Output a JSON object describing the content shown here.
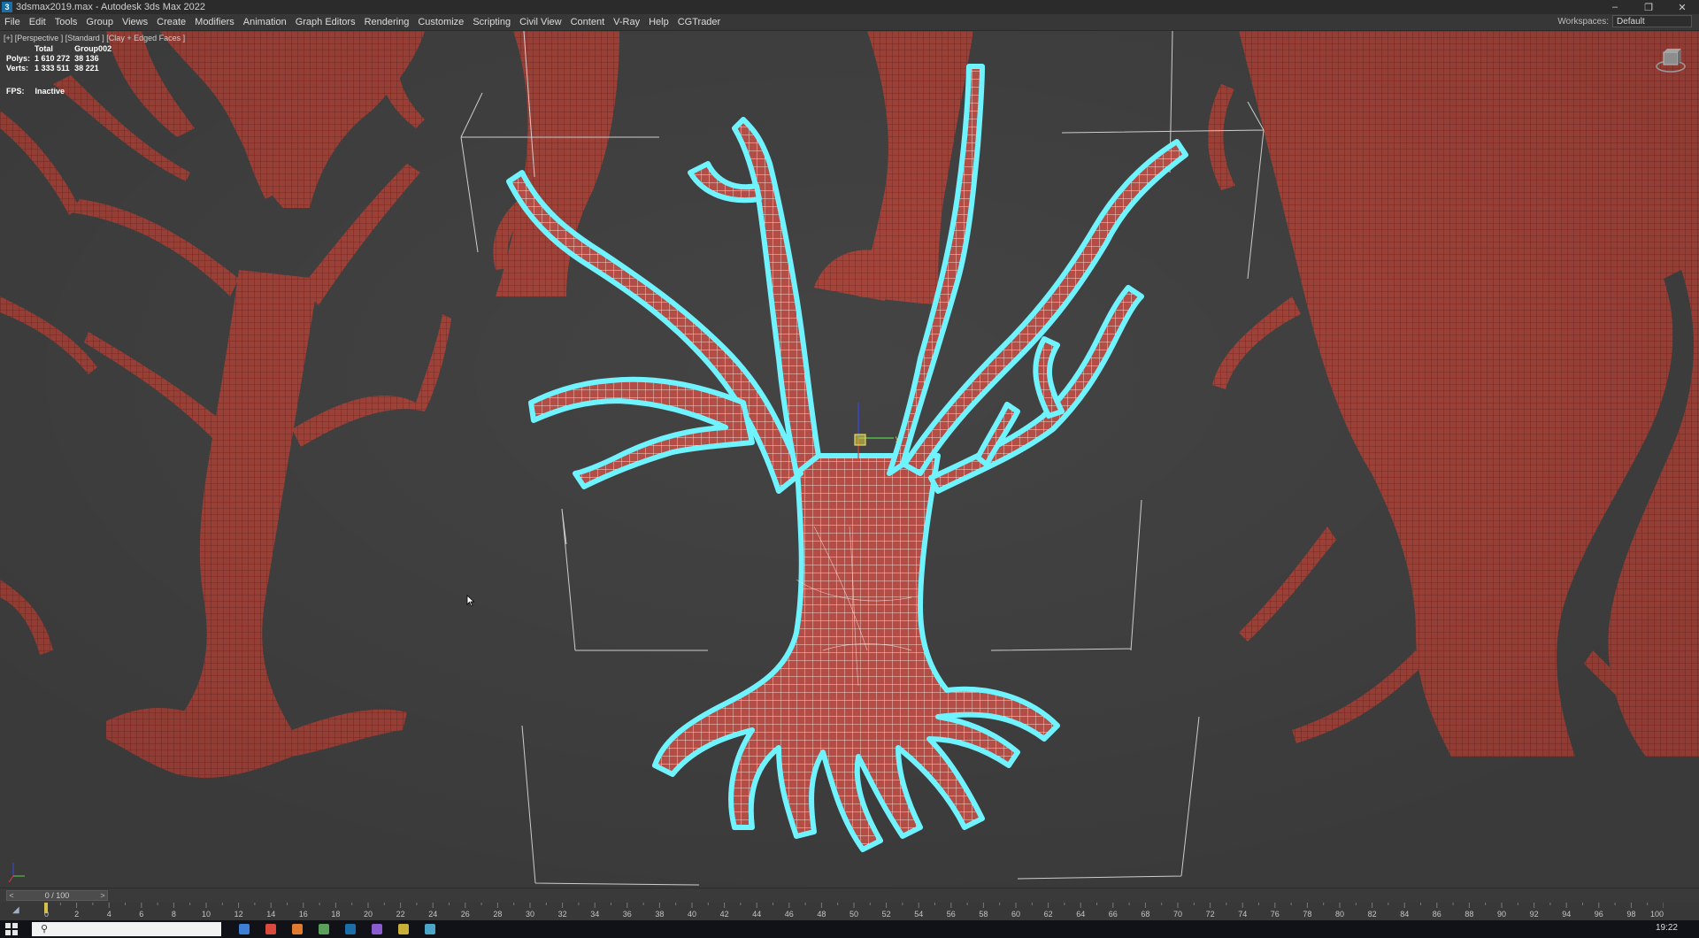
{
  "window": {
    "title": "3dsmax2019.max - Autodesk 3ds Max 2022",
    "app_icon": "3ds-max-icon",
    "controls": [
      "minimize-icon",
      "restore-icon",
      "close-icon"
    ]
  },
  "menubar": {
    "items": [
      "File",
      "Edit",
      "Tools",
      "Group",
      "Views",
      "Create",
      "Modifiers",
      "Animation",
      "Graph Editors",
      "Rendering",
      "Customize",
      "Scripting",
      "Civil View",
      "Content",
      "V-Ray",
      "Help",
      "CGTrader"
    ],
    "workspaces_label": "Workspaces:",
    "workspaces_value": "Default"
  },
  "viewport": {
    "label": "[+] [Perspective ] [Standard ] [Clay + Edged Faces ]",
    "stats": {
      "header_total": "Total",
      "header_selection": "Group002",
      "polys_label": "Polys:",
      "polys_total": "1 610 272",
      "polys_selection": "38 136",
      "verts_label": "Verts:",
      "verts_total": "1 333 511",
      "verts_selection": "38 221"
    },
    "fps_label": "FPS:",
    "fps_value": "Inactive",
    "gizmo_axis_label": "y",
    "colors": {
      "background": "#444444",
      "tree_clay": "#a8463c",
      "selection_outline": "#6ff3ff",
      "wire_highlight": "#ffffff"
    }
  },
  "timeline": {
    "frame_display": "0 / 100",
    "prev_label": "<",
    "next_label": ">",
    "ticks": [
      "0",
      "2",
      "4",
      "6",
      "8",
      "10",
      "12",
      "14",
      "16",
      "18",
      "20",
      "22",
      "24",
      "26",
      "28",
      "30",
      "32",
      "34",
      "36",
      "38",
      "40",
      "42",
      "44",
      "46",
      "48",
      "50",
      "52",
      "54",
      "56",
      "58",
      "60",
      "62",
      "64",
      "66",
      "68",
      "70",
      "72",
      "74",
      "76",
      "78",
      "80",
      "82",
      "84",
      "86",
      "88",
      "90",
      "92",
      "94",
      "96",
      "98",
      "100"
    ]
  },
  "taskbar": {
    "clock": "19:22"
  }
}
